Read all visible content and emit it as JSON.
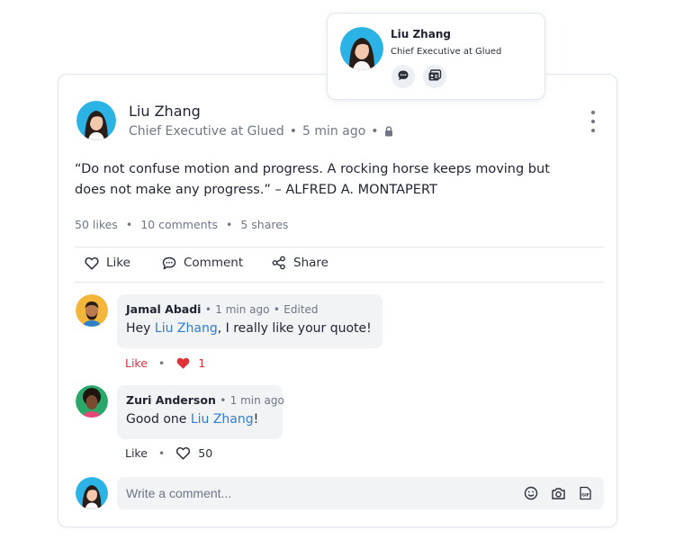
{
  "popover": {
    "name": "Liu Zhang",
    "title": "Chief Executive at Glued",
    "buttons": [
      {
        "icon": "message-icon"
      },
      {
        "icon": "contact-card-icon"
      }
    ]
  },
  "post": {
    "author": {
      "name": "Liu Zhang",
      "title": "Chief Executive at Glued",
      "time": "5 min ago",
      "visibility_icon": "lock-icon"
    },
    "quote": "“Do not confuse motion and progress. A rocking horse keeps moving but does not make any progress.” – ALFRED A. MONTAPERT",
    "stats": {
      "likes": "50 likes",
      "comments": "10 comments",
      "shares": "5 shares",
      "separator": "•"
    },
    "actions": {
      "like": "Like",
      "comment": "Comment",
      "share": "Share"
    }
  },
  "comments": [
    {
      "name": "Jamal Abadi",
      "time": "1 min ago",
      "edited": "Edited",
      "text_before": "Hey ",
      "mention": "Liu Zhang",
      "text_after": ", I really like your quote!",
      "like_label": "Like",
      "like_count": "1",
      "liked": true
    },
    {
      "name": "Zuri Anderson",
      "time": "1 min ago",
      "text_before": "Good one ",
      "mention": "Liu Zhang",
      "text_after": "!",
      "like_label": "Like",
      "like_count": "50",
      "liked": false
    }
  ],
  "composer": {
    "placeholder": "Write a comment...",
    "icons": [
      "emoji-icon",
      "camera-icon",
      "gif-icon"
    ]
  },
  "colors": {
    "accent": "#2f7dd6",
    "liked": "#e0313b",
    "muted": "#6f7785"
  }
}
